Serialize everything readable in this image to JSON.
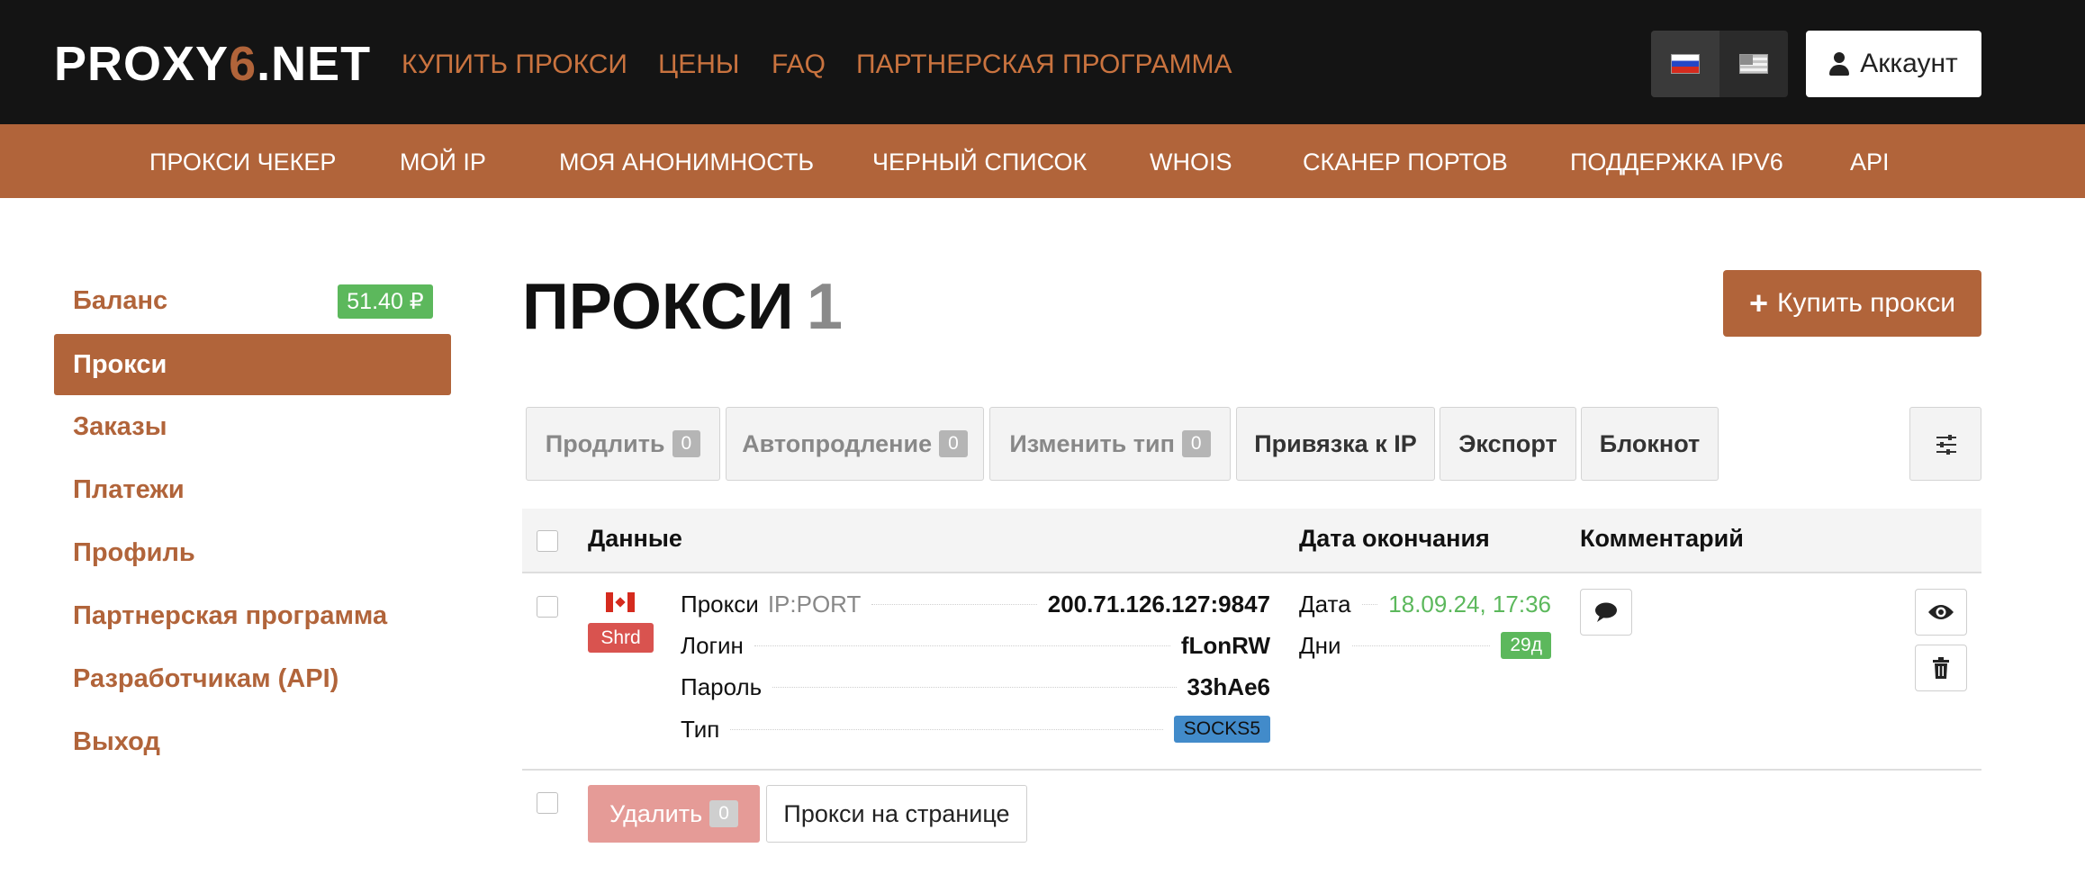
{
  "brand": {
    "logo_part1": "PROXY",
    "logo_part2": "6",
    "logo_part3": ".NET"
  },
  "top_nav": [
    "КУПИТЬ ПРОКСИ",
    "ЦЕНЫ",
    "FAQ",
    "ПАРТНЕРСКАЯ ПРОГРАММА"
  ],
  "languages": [
    {
      "icon": "flag-ru-icon",
      "active": true
    },
    {
      "icon": "flag-us-icon",
      "active": false
    }
  ],
  "account_label": "Аккаунт",
  "sub_nav": [
    "ПРОКСИ ЧЕКЕР",
    "МОЙ IP",
    "МОЯ АНОНИМНОСТЬ",
    "ЧЕРНЫЙ СПИСОК",
    "WHOIS",
    "СКАНЕР ПОРТОВ",
    "ПОДДЕРЖКА IPV6",
    "API"
  ],
  "sidebar": {
    "balance_label": "Баланс",
    "balance_value": "51.40 ₽",
    "items": [
      "Прокси",
      "Заказы",
      "Платежи",
      "Профиль",
      "Партнерская программа",
      "Разработчикам (API)",
      "Выход"
    ],
    "active_item": "Прокси"
  },
  "page": {
    "title": "ПРОКСИ",
    "count": "1",
    "buy_button": "Купить прокси"
  },
  "toolbar": {
    "extend": {
      "label": "Продлить",
      "count": "0"
    },
    "autorenew": {
      "label": "Автопродление",
      "count": "0"
    },
    "change_type": {
      "label": "Изменить тип",
      "count": "0"
    },
    "bind_ip": "Привязка к IP",
    "export": "Экспорт",
    "notepad": "Блокнот"
  },
  "table": {
    "headers": {
      "data": "Данные",
      "end_date": "Дата окончания",
      "comment": "Комментарий"
    },
    "rows": [
      {
        "country_flag": "flag-ca-icon",
        "type_badge": "Shrd",
        "proxy_label": "Прокси",
        "proxy_format": "IP:PORT",
        "proxy_value": "200.71.126.127:9847",
        "login_label": "Логин",
        "login_value": "fLonRW",
        "password_label": "Пароль",
        "password_value": "33hAe6",
        "type_label": "Тип",
        "type_value": "SOCKS5",
        "date_label": "Дата",
        "date_value": "18.09.24, 17:36",
        "days_label": "Дни",
        "days_value": "29д"
      }
    ]
  },
  "footer": {
    "delete_label": "Удалить",
    "delete_count": "0",
    "per_page_label": "Прокси на странице"
  },
  "colors": {
    "brand_orange": "#b1643a",
    "dark_bar": "#141414",
    "success_green": "#5cb85c",
    "danger_red": "#d9534f",
    "info_blue": "#428bca"
  }
}
